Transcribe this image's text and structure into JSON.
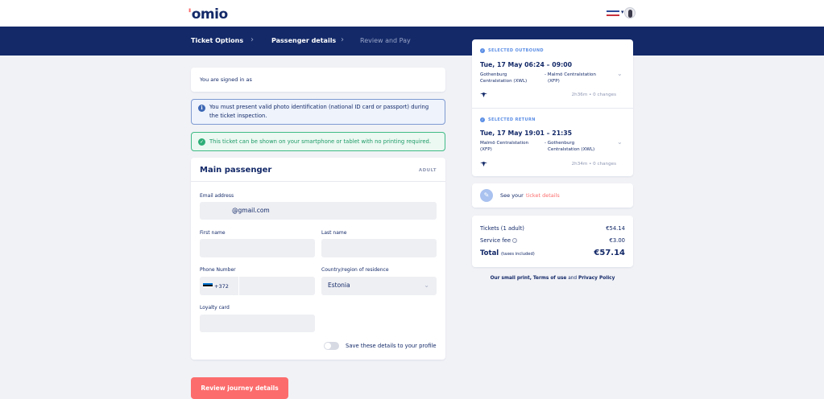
{
  "header": {
    "logo_main": "omio"
  },
  "steps": [
    {
      "label": "Ticket Options"
    },
    {
      "label": "Passenger details"
    },
    {
      "label": "Review and Pay"
    }
  ],
  "signed_in": "You are signed in as",
  "info_notice": {
    "line1": "You must present valid photo identification (national ID card or passport) during",
    "line2": "the ticket inspection."
  },
  "mobile_notice": "This ticket can be shown on your smartphone or tablet with no printing required.",
  "passenger": {
    "title": "Main passenger",
    "type": "ADULT",
    "email_label": "Email address",
    "email_value": "@gmail.com",
    "first_name_label": "First name",
    "last_name_label": "Last name",
    "phone_label": "Phone Number",
    "phone_code": "+372",
    "country_label": "Country/region of residence",
    "country_value": "Estonia",
    "loyalty_label": "Loyalty card",
    "save_label": "Save these details to your profile"
  },
  "cta_label": "Review journey details",
  "outbound": {
    "label": "SELECTED OUTBOUND",
    "date_time": "Tue, 17 May   06:24 – 09:00",
    "from_1": "Gothenburg",
    "from_2": "Centralstation (XWL)",
    "to_1": "- Malmö Centralstation",
    "to_2": "(XFP)",
    "summary": "2h36m • 0 changes"
  },
  "return": {
    "label": "SELECTED RETURN",
    "date_time": "Tue, 17 May   19:01 – 21:35",
    "from_1": "Malmö Centralstation",
    "from_2": "(XFP)",
    "to_1": "- Gothenburg",
    "to_2": "Centralstation (XWL)",
    "summary": "2h34m • 0 changes"
  },
  "ticket_details": {
    "lead": "See your",
    "link": "ticket details"
  },
  "pricing": {
    "tickets_label": "Tickets  (1 adult)",
    "tickets_value": "€54.14",
    "fee_label": "Service fee",
    "fee_value": "€3.00",
    "total_label": "Total",
    "total_note": "(taxes included)",
    "total_value": "€57.14"
  },
  "footer": {
    "part1": "Our small print,",
    "part2": "Terms of use",
    "part3": "and",
    "part4": "Privacy Policy"
  },
  "colors": {
    "navy": "#132968",
    "coral": "#fc6c6c",
    "info_blue": "#3d68b5",
    "success_green": "#2fae78"
  }
}
